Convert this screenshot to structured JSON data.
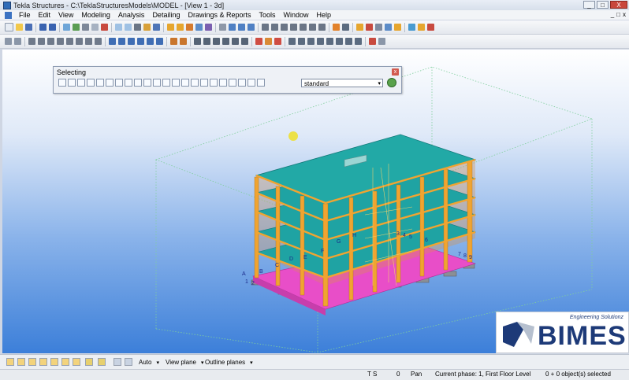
{
  "window": {
    "title": "Tekla Structures - C:\\TeklaStructuresModels\\MODEL - [View 1 - 3d]",
    "buttons": [
      "_",
      "□",
      "X"
    ]
  },
  "menu": {
    "items": [
      "File",
      "Edit",
      "View",
      "Modeling",
      "Analysis",
      "Detailing",
      "Drawings & Reports",
      "Tools",
      "Window",
      "Help"
    ],
    "mdi_buttons": [
      "_",
      "□",
      "x"
    ]
  },
  "selecting_panel": {
    "title": "Selecting",
    "close": "x",
    "filter_value": "standard",
    "dropdown_arrow": "▾"
  },
  "status": {
    "view_dropdowns": [
      {
        "value": "Auto"
      },
      {
        "value": "View plane"
      },
      {
        "value": "Outline planes"
      }
    ],
    "dropdown_arrow": "▾"
  },
  "info": {
    "ts": "T S",
    "count": "0",
    "mode": "Pan",
    "phase": "Current phase: 1,  First Floor Level",
    "selected": "0 + 0 object(s) selected"
  },
  "logo": {
    "tagline": "Engineering Solutionz",
    "brand": "BIMES"
  },
  "grid_labels": {
    "left": [
      "A",
      "B",
      "C",
      "D"
    ],
    "front": [
      "E",
      "F",
      "G",
      "H"
    ],
    "right": [
      "7",
      "8",
      "9"
    ],
    "numbers": [
      "1",
      "2",
      "3",
      "4",
      "5",
      "6"
    ]
  },
  "colors": {
    "slab": "#1fa3a3",
    "column": "#f0a431",
    "foundation": "#e84ec8",
    "footing": "#8a8f96"
  },
  "icons": {
    "app": "tekla-icon",
    "cursor": "mouse-pointer-icon"
  }
}
